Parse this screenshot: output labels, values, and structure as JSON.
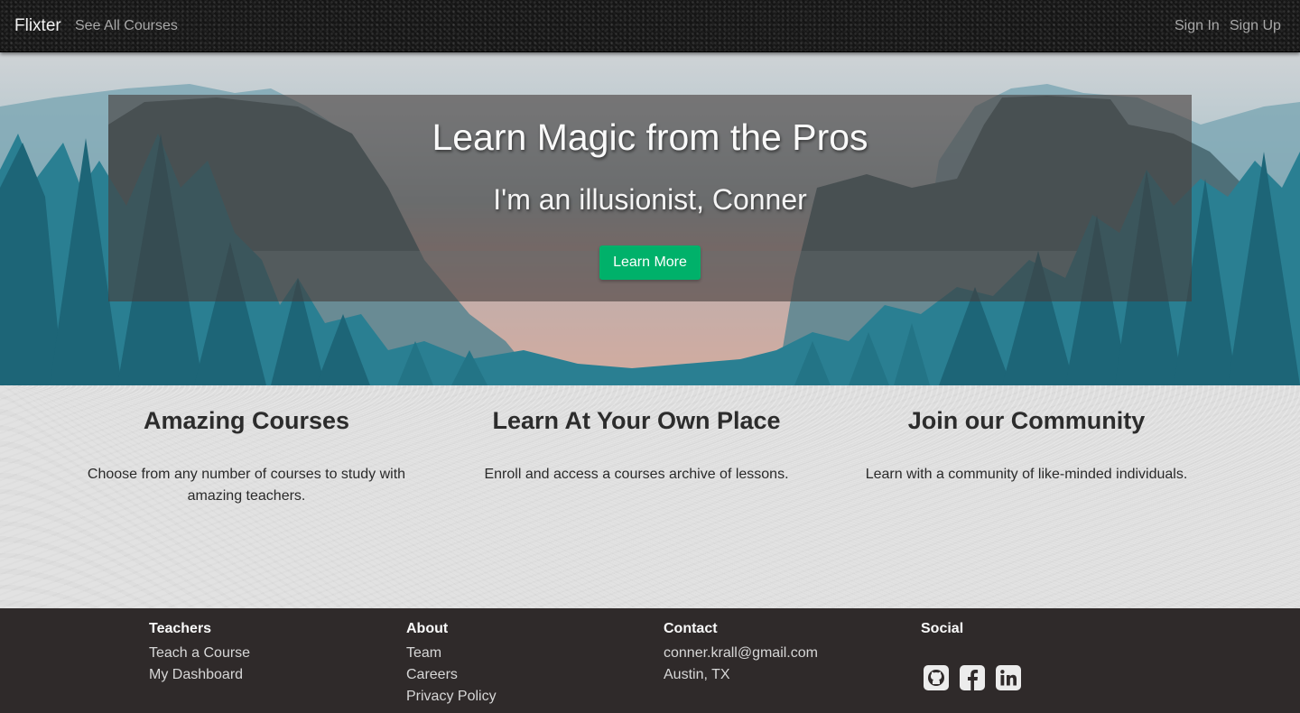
{
  "navbar": {
    "brand": "Flixter",
    "see_all_courses": "See All Courses",
    "sign_in": "Sign In",
    "sign_up": "Sign Up"
  },
  "hero": {
    "title": "Learn Magic from the Pros",
    "subtitle": "I'm an illusionist, Conner",
    "button_label": "Learn More",
    "button_color": "#00b16a"
  },
  "features": [
    {
      "title": "Amazing Courses",
      "text": "Choose from any number of courses to study with amazing teachers."
    },
    {
      "title": "Learn At Your Own Place",
      "text": "Enroll and access a courses archive of lessons."
    },
    {
      "title": "Join our Community",
      "text": "Learn with a community of like-minded individuals."
    }
  ],
  "footer": {
    "teachers": {
      "heading": "Teachers",
      "links": [
        "Teach a Course",
        "My Dashboard"
      ]
    },
    "about": {
      "heading": "About",
      "links": [
        "Team",
        "Careers",
        "Privacy Policy"
      ]
    },
    "contact": {
      "heading": "Contact",
      "email": "conner.krall@gmail.com",
      "location": "Austin, TX"
    },
    "social": {
      "heading": "Social",
      "icons": [
        "github-icon",
        "facebook-icon",
        "linkedin-icon"
      ]
    },
    "background": "#2f2a2a"
  }
}
